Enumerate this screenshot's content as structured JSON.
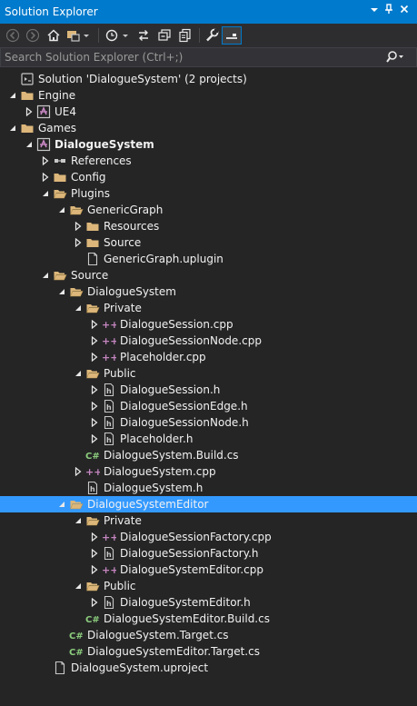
{
  "window": {
    "title": "Solution Explorer",
    "buttons": [
      "dropdown",
      "pin",
      "close"
    ]
  },
  "toolbar": {
    "buttons": [
      "back-icon",
      "forward-icon",
      "home-icon",
      "switch-views-icon",
      "pending-changes-icon",
      "sync-icon",
      "collapse-all-icon",
      "show-all-files-icon",
      "properties-icon",
      "preview-icon"
    ]
  },
  "search": {
    "placeholder": "Search Solution Explorer (Ctrl+;)"
  },
  "colors": {
    "accent": "#007acc",
    "selection": "#3399ff",
    "folder": "#dcb67a",
    "cpp": "#c586c0",
    "csharp": "#8ccd7d"
  },
  "tree": [
    {
      "label": "Solution 'DialogueSystem' (2 projects)",
      "level": 0,
      "arrow": "none",
      "icon": "solution"
    },
    {
      "label": "Engine",
      "level": 0,
      "arrow": "expanded",
      "icon": "folder"
    },
    {
      "label": "UE4",
      "level": 1,
      "arrow": "collapsed",
      "icon": "project"
    },
    {
      "label": "Games",
      "level": 0,
      "arrow": "expanded",
      "icon": "folder"
    },
    {
      "label": "DialogueSystem",
      "level": 1,
      "arrow": "expanded",
      "icon": "project",
      "bold": true
    },
    {
      "label": "References",
      "level": 2,
      "arrow": "collapsed",
      "icon": "references"
    },
    {
      "label": "Config",
      "level": 2,
      "arrow": "collapsed",
      "icon": "folder"
    },
    {
      "label": "Plugins",
      "level": 2,
      "arrow": "expanded",
      "icon": "folder-open"
    },
    {
      "label": "GenericGraph",
      "level": 3,
      "arrow": "expanded",
      "icon": "folder-open"
    },
    {
      "label": "Resources",
      "level": 4,
      "arrow": "collapsed",
      "icon": "folder"
    },
    {
      "label": "Source",
      "level": 4,
      "arrow": "collapsed",
      "icon": "folder"
    },
    {
      "label": "GenericGraph.uplugin",
      "level": 4,
      "arrow": "none",
      "icon": "file"
    },
    {
      "label": "Source",
      "level": 2,
      "arrow": "expanded",
      "icon": "folder-open"
    },
    {
      "label": "DialogueSystem",
      "level": 3,
      "arrow": "expanded",
      "icon": "folder-open"
    },
    {
      "label": "Private",
      "level": 4,
      "arrow": "expanded",
      "icon": "folder-open"
    },
    {
      "label": "DialogueSession.cpp",
      "level": 5,
      "arrow": "collapsed",
      "icon": "cpp"
    },
    {
      "label": "DialogueSessionNode.cpp",
      "level": 5,
      "arrow": "collapsed",
      "icon": "cpp"
    },
    {
      "label": "Placeholder.cpp",
      "level": 5,
      "arrow": "collapsed",
      "icon": "cpp"
    },
    {
      "label": "Public",
      "level": 4,
      "arrow": "expanded",
      "icon": "folder-open"
    },
    {
      "label": "DialogueSession.h",
      "level": 5,
      "arrow": "collapsed",
      "icon": "header"
    },
    {
      "label": "DialogueSessionEdge.h",
      "level": 5,
      "arrow": "collapsed",
      "icon": "header"
    },
    {
      "label": "DialogueSessionNode.h",
      "level": 5,
      "arrow": "collapsed",
      "icon": "header"
    },
    {
      "label": "Placeholder.h",
      "level": 5,
      "arrow": "collapsed",
      "icon": "header"
    },
    {
      "label": "DialogueSystem.Build.cs",
      "level": 4,
      "arrow": "none",
      "icon": "csharp"
    },
    {
      "label": "DialogueSystem.cpp",
      "level": 4,
      "arrow": "collapsed",
      "icon": "cpp"
    },
    {
      "label": "DialogueSystem.h",
      "level": 4,
      "arrow": "none",
      "icon": "header"
    },
    {
      "label": "DialogueSystemEditor",
      "level": 3,
      "arrow": "expanded",
      "icon": "folder-open",
      "selected": true
    },
    {
      "label": "Private",
      "level": 4,
      "arrow": "expanded",
      "icon": "folder-open"
    },
    {
      "label": "DialogueSessionFactory.cpp",
      "level": 5,
      "arrow": "collapsed",
      "icon": "cpp"
    },
    {
      "label": "DialogueSessionFactory.h",
      "level": 5,
      "arrow": "collapsed",
      "icon": "header"
    },
    {
      "label": "DialogueSystemEditor.cpp",
      "level": 5,
      "arrow": "collapsed",
      "icon": "cpp"
    },
    {
      "label": "Public",
      "level": 4,
      "arrow": "expanded",
      "icon": "folder-open"
    },
    {
      "label": "DialogueSystemEditor.h",
      "level": 5,
      "arrow": "collapsed",
      "icon": "header"
    },
    {
      "label": "DialogueSystemEditor.Build.cs",
      "level": 4,
      "arrow": "none",
      "icon": "csharp"
    },
    {
      "label": "DialogueSystem.Target.cs",
      "level": 3,
      "arrow": "none",
      "icon": "csharp"
    },
    {
      "label": "DialogueSystemEditor.Target.cs",
      "level": 3,
      "arrow": "none",
      "icon": "csharp"
    },
    {
      "label": "DialogueSystem.uproject",
      "level": 2,
      "arrow": "none",
      "icon": "file"
    }
  ]
}
